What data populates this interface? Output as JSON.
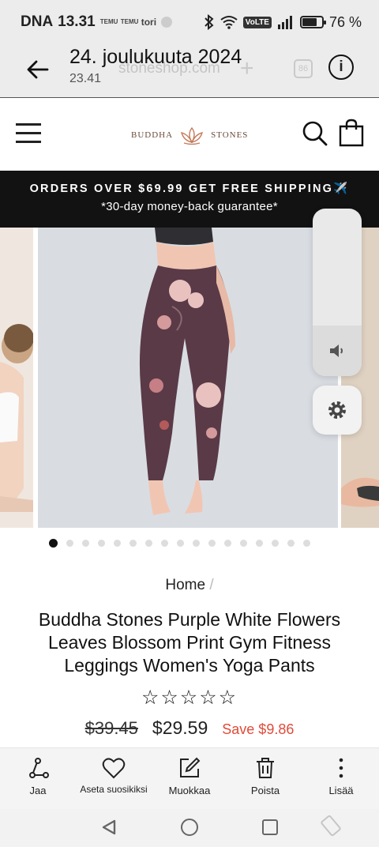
{
  "status": {
    "carrier": "DNA",
    "time": "13.31",
    "icons": [
      "temu-notification-icon",
      "temu-notification-icon",
      "tori-notification-icon",
      "messenger-icon"
    ],
    "mini1": "TEMU",
    "mini2": "TEMU",
    "tori": "tori",
    "right_icons": [
      "bluetooth-icon",
      "wifi-icon",
      "volte-icon",
      "signal-icon",
      "battery-icon"
    ],
    "volte": "VoLTE",
    "battery_percent": 76,
    "battery_text": "76 %"
  },
  "gallery_header": {
    "title": "24. joulukuuta 2024",
    "subtitle": "23.41",
    "ghost_url": "stoneshop.com",
    "ghost_tab_count": "86"
  },
  "site": {
    "logo_left": "BUDDHA",
    "logo_right": "STONES"
  },
  "promo": {
    "line1": "ORDERS OVER $69.99 GET FREE SHIPPING✈️",
    "line2": "*30-day money-back guarantee*"
  },
  "gallery": {
    "total_slides": 17,
    "active_index": 0
  },
  "volume_level": 0.3,
  "product": {
    "breadcrumb_home": "Home",
    "breadcrumb_sep": "/",
    "title": "Buddha Stones Purple White Flowers Leaves Blossom Print Gym Fitness Leggings Women's Yoga Pants",
    "stars": "☆☆☆☆☆",
    "old_price": "$39.45",
    "new_price": "$29.59",
    "save": "Save $9.86"
  },
  "toolbar": {
    "share": "Jaa",
    "favorite": "Aseta suosikiksi",
    "edit": "Muokkaa",
    "delete": "Poista",
    "more": "Lisää"
  },
  "colors": {
    "promo_bg": "#121212",
    "save": "#e04b3a",
    "legging": "#5a3a47"
  }
}
